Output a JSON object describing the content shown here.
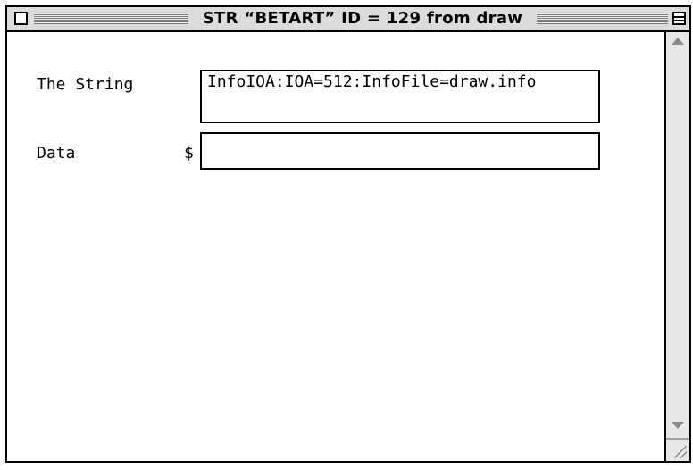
{
  "window": {
    "title": "STR “BETART” ID = 129 from draw"
  },
  "form": {
    "the_string_label": "The String",
    "the_string_value": "InfoIOA:IOA=512:InfoFile=draw.info",
    "data_label": "Data",
    "data_prefix": "$",
    "data_value": ""
  },
  "icons": {
    "close": "close-box-icon",
    "collapse": "collapse-box-icon",
    "scroll_up": "arrow-up-icon",
    "scroll_down": "arrow-down-icon",
    "resize": "grow-box-icon"
  },
  "colors": {
    "titlebar": "#dcdcdc",
    "border": "#000000",
    "scrollbar": "#e8e8e8"
  }
}
